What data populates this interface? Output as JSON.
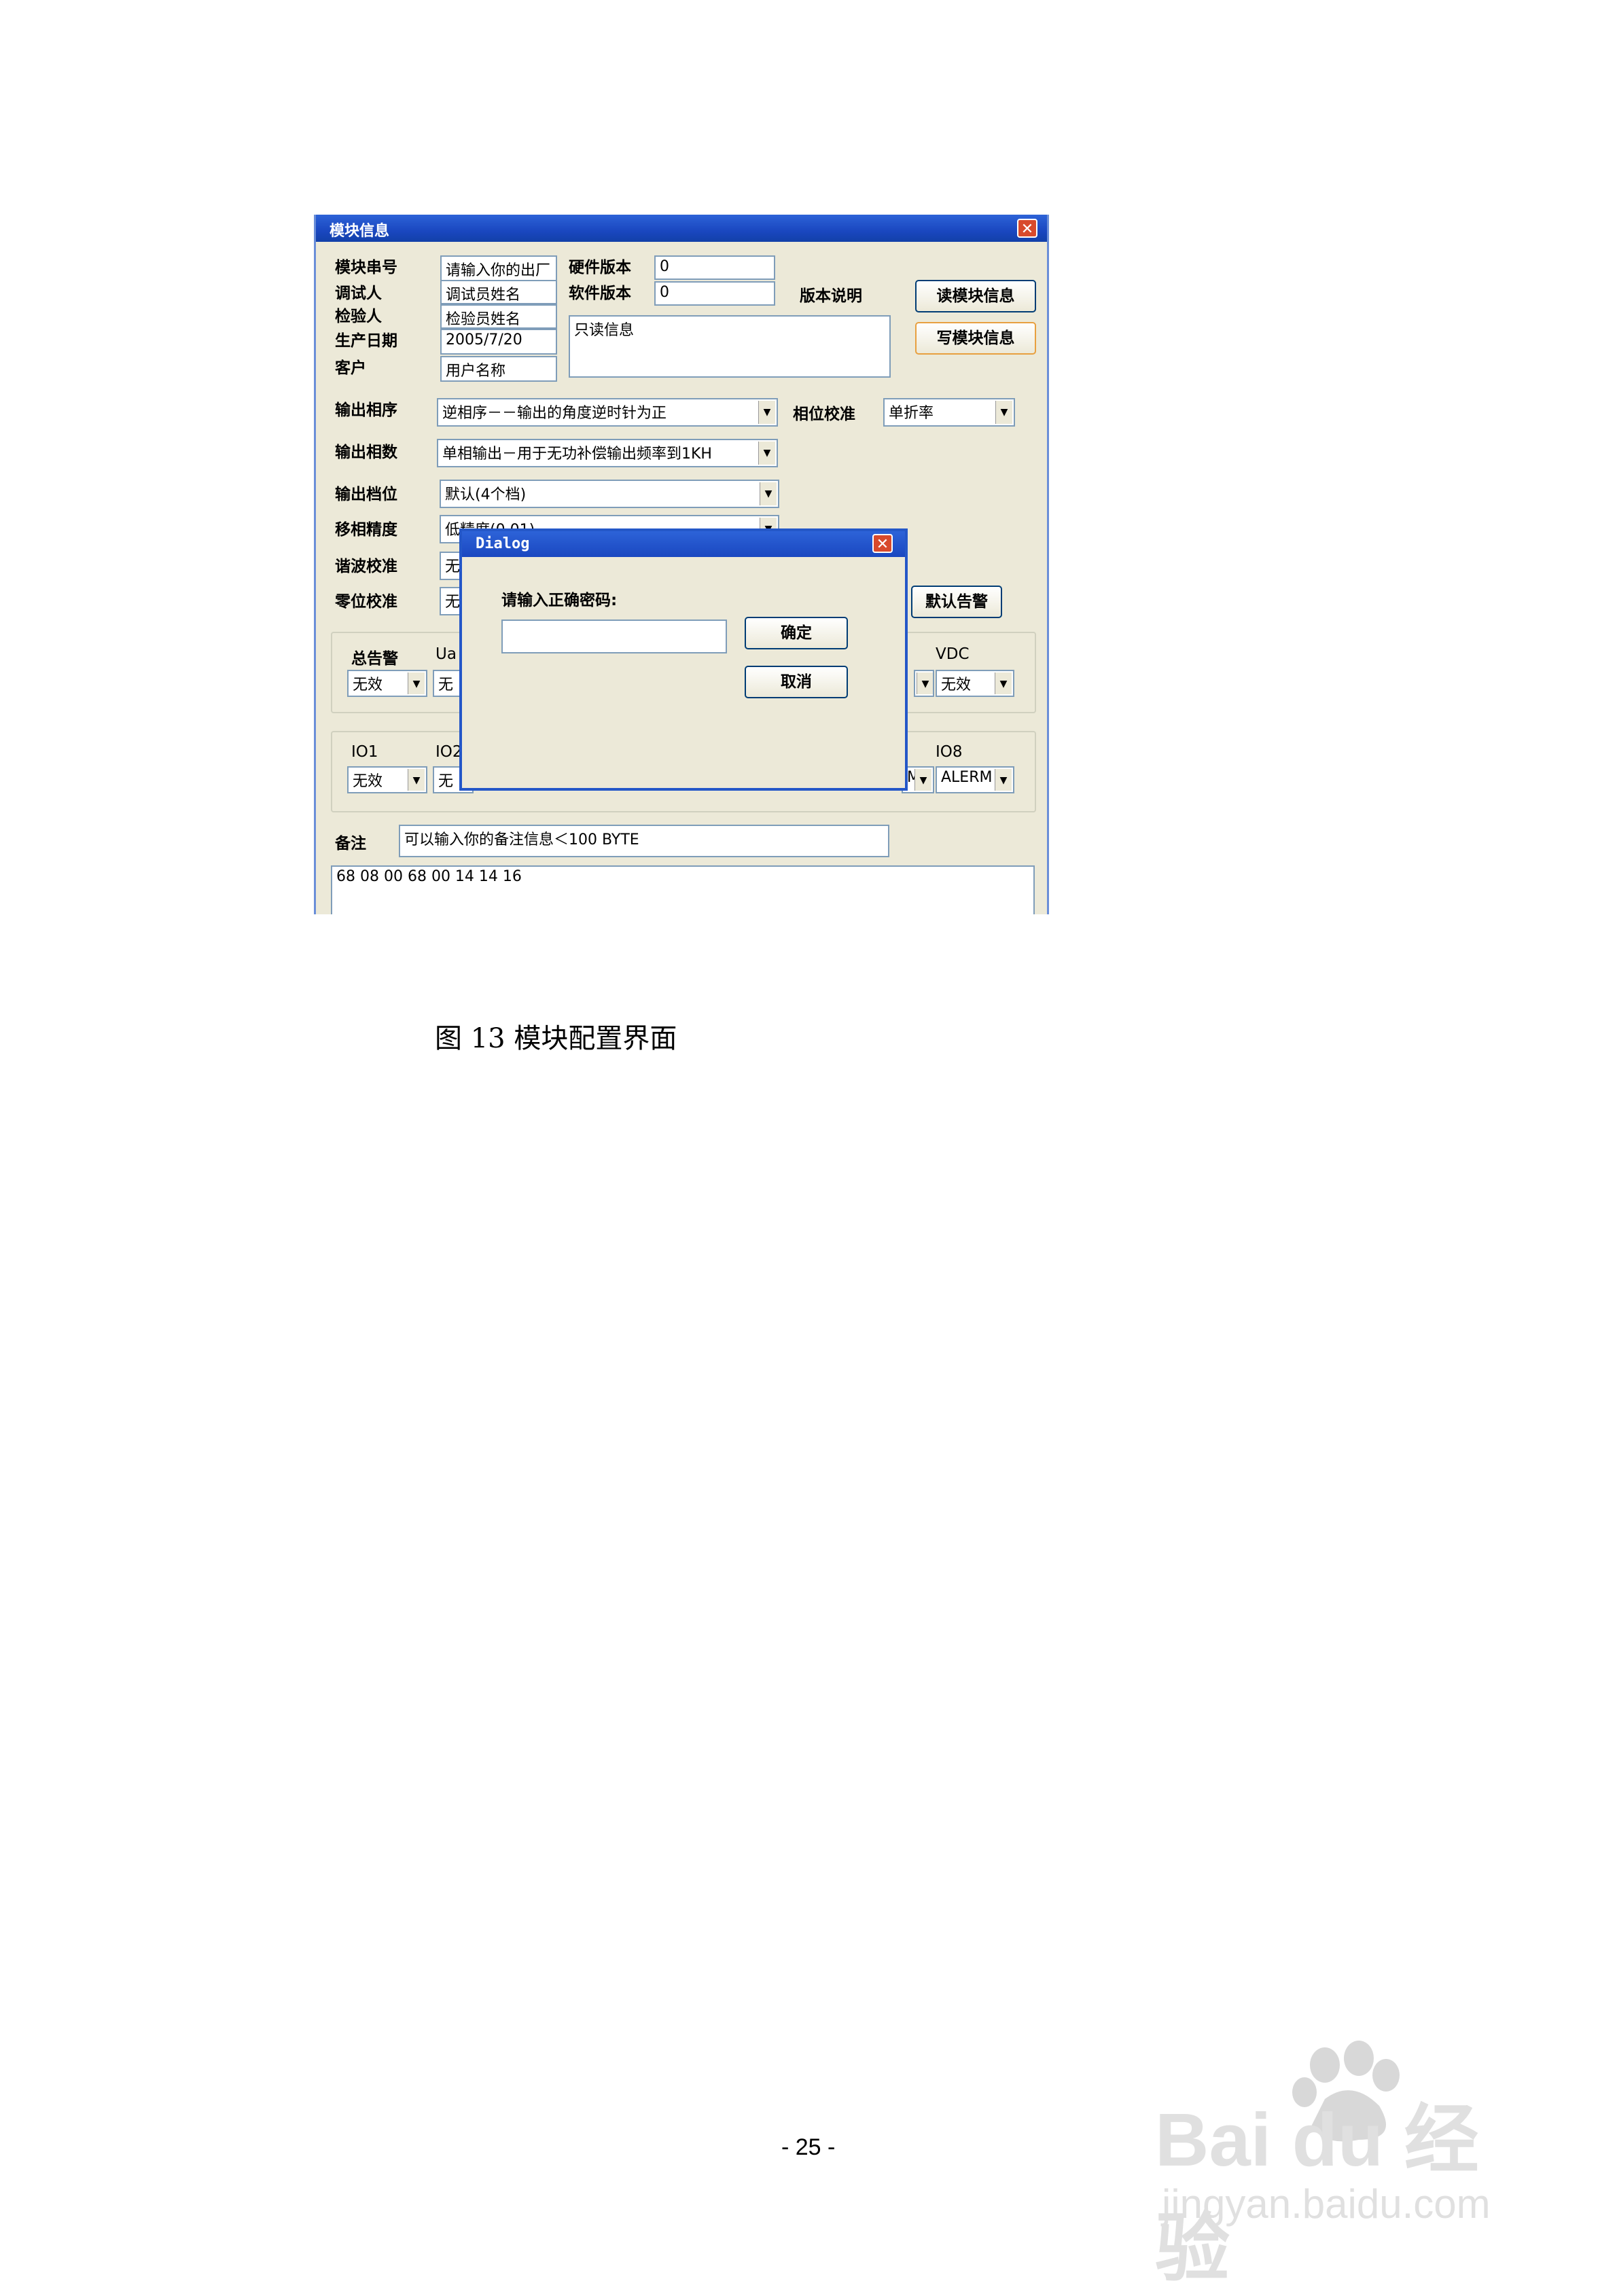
{
  "window": {
    "title": "模块信息",
    "labels": {
      "serial": "模块串号",
      "tester": "调试人",
      "inspector": "检验人",
      "prod_date": "生产日期",
      "customer": "客户",
      "hw_version": "硬件版本",
      "sw_version": "软件版本",
      "version_note": "版本说明",
      "phase_seq": "输出相序",
      "phase_cal": "相位校准",
      "phase_count": "输出相数",
      "gear": "输出档位",
      "phase_precision": "移相精度",
      "harmonic_cal": "谐波校准",
      "zero_cal": "零位校准",
      "remark": "备注"
    },
    "fields": {
      "serial": "请输入你的出厂",
      "tester": "调试员姓名",
      "inspector": "检验员姓名",
      "prod_date": "2005/7/20",
      "customer": "用户名称",
      "hw_version": "0",
      "sw_version": "0",
      "readonly_info": "只读信息",
      "remark": "可以输入你的备注信息＜100 BYTE",
      "hex_output": "68 08 00 68 00 14 14 16"
    },
    "combos": {
      "phase_seq": "逆相序－－输出的角度逆时针为正",
      "phase_cal": "单折率",
      "phase_count": "单相输出－用于无功补偿输出频率到1KH",
      "gear": "默认(4个档)",
      "phase_precision": "低精度(0.01)",
      "harmonic_cal": "无",
      "zero_cal": "无"
    },
    "buttons": {
      "read": "读模块信息",
      "write": "写模块信息",
      "default_alarm": "默认告警"
    },
    "alarm_group": {
      "total_label": "总告警",
      "total_value": "无效",
      "ua_label": "Ua",
      "ua_value": "无",
      "vdc_label": "VDC",
      "vdc_value": "无效",
      "m_value": ""
    },
    "io_group": {
      "io1_label": "IO1",
      "io1_value": "无效",
      "io2_label": "IO2",
      "io2_value": "无",
      "io8_label": "IO8",
      "io8_value": "ALERM",
      "m_value": "M"
    }
  },
  "dialog": {
    "title": "Dialog",
    "prompt": "请输入正确密码:",
    "password_value": "",
    "ok": "确定",
    "cancel": "取消"
  },
  "caption": "图  13  模块配置界面",
  "page_number": "- 25 -",
  "watermark": {
    "brand": "Bai du 经验",
    "url": "jingyan.baidu.com"
  }
}
